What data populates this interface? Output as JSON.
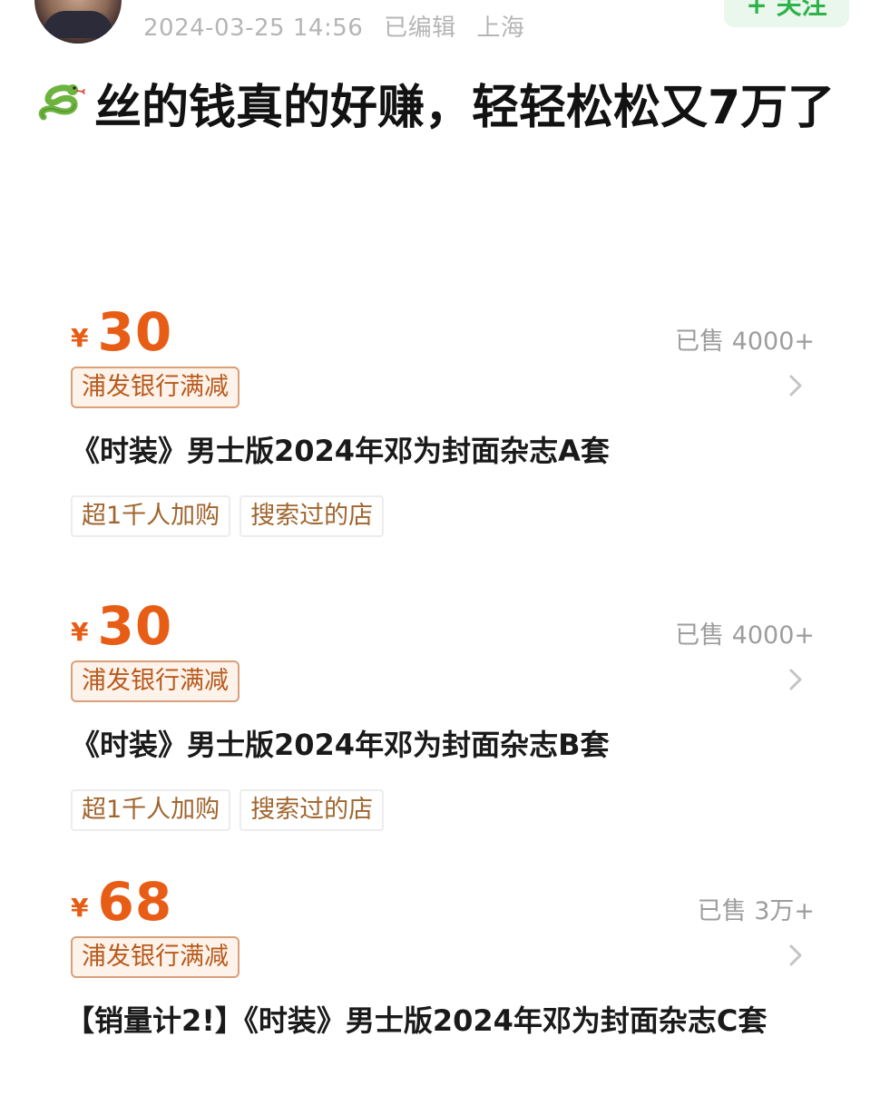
{
  "post": {
    "meta_date": "2024-03-25 14:56",
    "meta_edited": "已编辑",
    "meta_location": "上海",
    "follow_label": "+ 关注",
    "title": "丝的钱真的好赚，轻轻松松又7万了",
    "title_emoji": "snake-emoji-icon"
  },
  "products": [
    {
      "currency": "¥",
      "price": "30",
      "sold": "已售 4000+",
      "promo": "浦发银行满减",
      "name": "《时装》男士版2024年邓为封面杂志A套",
      "tags": [
        "超1千人加购",
        "搜索过的店"
      ]
    },
    {
      "currency": "¥",
      "price": "30",
      "sold": "已售 4000+",
      "promo": "浦发银行满减",
      "name": "《时装》男士版2024年邓为封面杂志B套",
      "tags": [
        "超1千人加购",
        "搜索过的店"
      ]
    },
    {
      "currency": "¥",
      "price": "68",
      "sold": "已售 3万+",
      "promo": "浦发银行满减",
      "name": "【销量计2!】《时装》男士版2024年邓为封面杂志C套",
      "tags": []
    }
  ],
  "colors": {
    "price": "#e85d16",
    "follow": "#2fb24a",
    "promo_border": "#d9a07a"
  }
}
